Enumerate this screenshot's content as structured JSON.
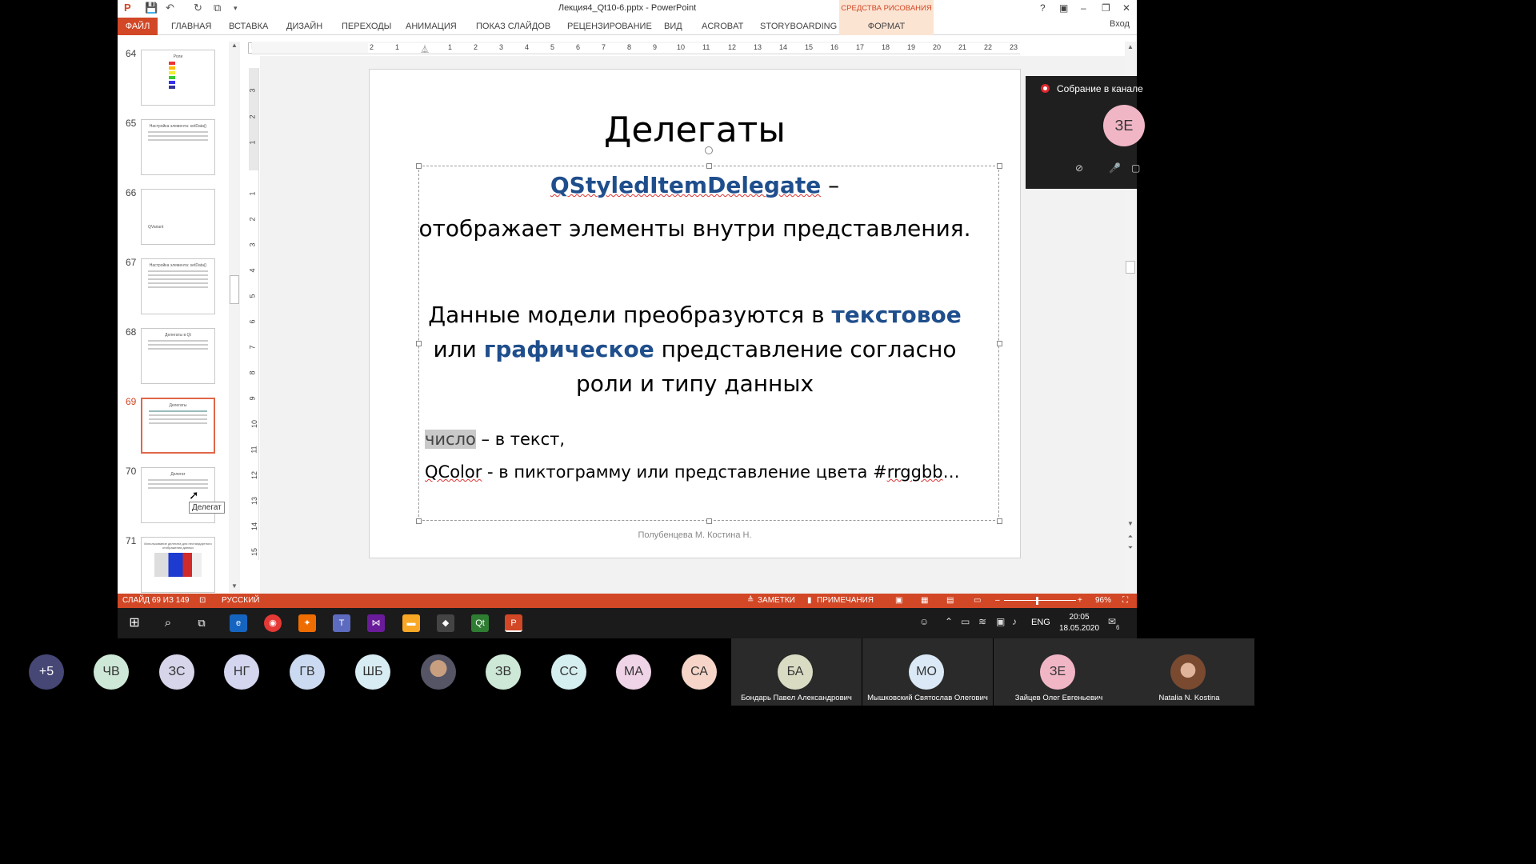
{
  "window": {
    "title": "Лекция4_Qt10-6.pptx - PowerPoint",
    "context_tab_group": "СРЕДСТВА РИСОВАНИЯ",
    "controls": [
      "?",
      "▣",
      "–",
      "❐",
      "✕"
    ],
    "signin": "Вход"
  },
  "ribbon": {
    "tabs": [
      "ФАЙЛ",
      "ГЛАВНАЯ",
      "ВСТАВКА",
      "ДИЗАЙН",
      "ПЕРЕХОДЫ",
      "АНИМАЦИЯ",
      "ПОКАЗ СЛАЙДОВ",
      "РЕЦЕНЗИРОВАНИЕ",
      "ВИД",
      "ACROBAT",
      "STORYBOARDING"
    ],
    "format_tab": "ФОРМАТ"
  },
  "ruler": {
    "horizontal": [
      "2",
      "1",
      "1",
      "2",
      "3",
      "4",
      "5",
      "6",
      "7",
      "8",
      "9",
      "10",
      "11",
      "12",
      "13",
      "14",
      "15",
      "16",
      "17",
      "18",
      "19",
      "20",
      "21",
      "22",
      "23"
    ],
    "vertical": [
      "3",
      "2",
      "1",
      "1",
      "2",
      "3",
      "4",
      "5",
      "6",
      "7",
      "8",
      "9",
      "10",
      "11",
      "12",
      "13",
      "14",
      "15"
    ],
    "corner": "L"
  },
  "thumbnails": [
    {
      "number": "64",
      "title": "Роли"
    },
    {
      "number": "65",
      "title": "Настройка элемента: setData()"
    },
    {
      "number": "66",
      "title": "QVariant"
    },
    {
      "number": "67",
      "title": "Настройка элемента: setData()"
    },
    {
      "number": "68",
      "title": "Делегаты в Qt"
    },
    {
      "number": "69",
      "title": "Делегаты"
    },
    {
      "number": "70",
      "title": "Делегат"
    },
    {
      "number": "71",
      "title": "Использование делегата для нестандартного отображения данных"
    }
  ],
  "tooltip": "Делегат",
  "slide": {
    "title": "Делегаты",
    "line1_keyword": "QStyledItemDelegate",
    "line1_rest": " –",
    "line2": "отображает элементы внутри представления.",
    "line3_a": "Данные модели  преобразуются в ",
    "line3_b": "текстовое",
    "line3_c": "или ",
    "line3_d": "графическое",
    "line3_e": " представление согласно",
    "line3_f": "роли и типу данных",
    "line4_highlight": "число",
    "line4_rest": " – в текст,",
    "line5_keyword": "QColor",
    "line5_a": " -  в пиктограмму или представление цвета #",
    "line5_b": "rrggbb",
    "line5_c": "…",
    "footer": "Полубенцева М. Костина Н."
  },
  "status": {
    "slide_counter": "СЛАЙД 69 ИЗ 149",
    "language": "РУССКИЙ",
    "notes": "ЗАМЕТКИ",
    "comments": "ПРИМЕЧАНИЯ",
    "zoom": "96%"
  },
  "meeting": {
    "title": "Собрание в канале",
    "avatar": "ЗЕ"
  },
  "taskbar": {
    "lang": "ENG",
    "time": "20:05",
    "date": "18.05.2020",
    "notifications": "6"
  },
  "participants": {
    "more": "+5",
    "avatars": [
      "ЧВ",
      "ЗС",
      "НГ",
      "ГВ",
      "ШБ",
      "",
      "ЗВ",
      "СС",
      "МА",
      "СА"
    ],
    "tiles": [
      {
        "initials": "БА",
        "name": "Бондарь Павел Александрович"
      },
      {
        "initials": "МО",
        "name": "Мышковский Святослав Олегович"
      },
      {
        "initials": "ЗЕ",
        "name": "Зайцев Олег Евгеньевич"
      },
      {
        "initials": "",
        "name": "Natalia N. Kostina"
      }
    ]
  },
  "colors": {
    "accent": "#d24726",
    "keyword_blue": "#1f4e8c"
  }
}
